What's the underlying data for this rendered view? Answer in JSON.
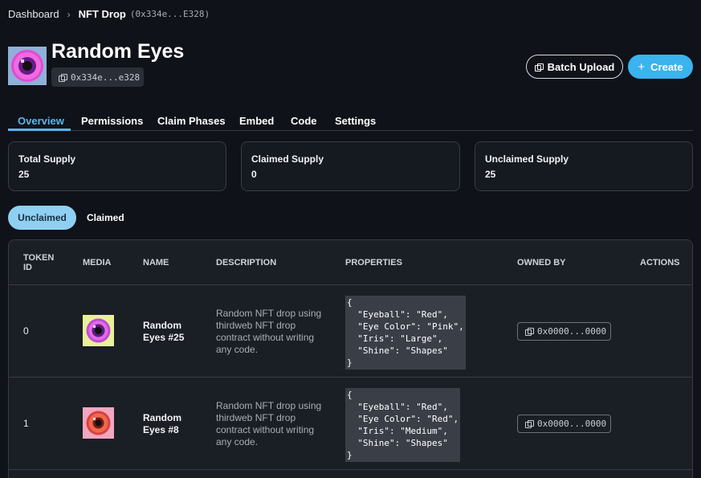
{
  "breadcrumb": {
    "root": "Dashboard",
    "separator": "›",
    "current": "NFT Drop",
    "address": "(0x334e...E328)"
  },
  "header": {
    "title": "Random Eyes",
    "address": "0x334e...e328"
  },
  "actions": {
    "batch_upload": "Batch Upload",
    "create": "Create"
  },
  "tabs": [
    {
      "label": "Overview"
    },
    {
      "label": "Permissions"
    },
    {
      "label": "Claim Phases"
    },
    {
      "label": "Embed"
    },
    {
      "label": "Code"
    },
    {
      "label": "Settings"
    }
  ],
  "stats": [
    {
      "label": "Total Supply",
      "value": "25"
    },
    {
      "label": "Claimed Supply",
      "value": "0"
    },
    {
      "label": "Unclaimed Supply",
      "value": "25"
    }
  ],
  "subtabs": {
    "active": "Unclaimed",
    "other": "Claimed"
  },
  "table": {
    "columns": {
      "token_id": "TOKEN ID",
      "media": "MEDIA",
      "name": "NAME",
      "description": "DESCRIPTION",
      "properties": "PROPERTIES",
      "owned_by": "OWNED BY",
      "actions": "ACTIONS"
    },
    "rows": [
      {
        "id": "0",
        "name": "Random Eyes #25",
        "description": "Random NFT drop using thirdweb NFT drop contract without writing any code.",
        "properties": "{\n  \"Eyeball\": \"Red\",\n  \"Eye Color\": \"Pink\",\n  \"Iris\": \"Large\",\n  \"Shine\": \"Shapes\"\n}",
        "owner": "0x0000...0000"
      },
      {
        "id": "1",
        "name": "Random Eyes #8",
        "description": "Random NFT drop using thirdweb NFT drop contract without writing any code.",
        "properties": "{\n  \"Eyeball\": \"Red\",\n  \"Eye Color\": \"Red\",\n  \"Iris\": \"Medium\",\n  \"Shine\": \"Shapes\"\n}",
        "owner": "0x0000...0000"
      }
    ]
  },
  "colors": {
    "accent": "#59b7ef",
    "primary_button": "#3ab3ee",
    "background": "#0f1218"
  },
  "icons": {
    "copy": "copy-icon",
    "plus": "plus-icon",
    "chevron": "chevron-right-icon"
  }
}
